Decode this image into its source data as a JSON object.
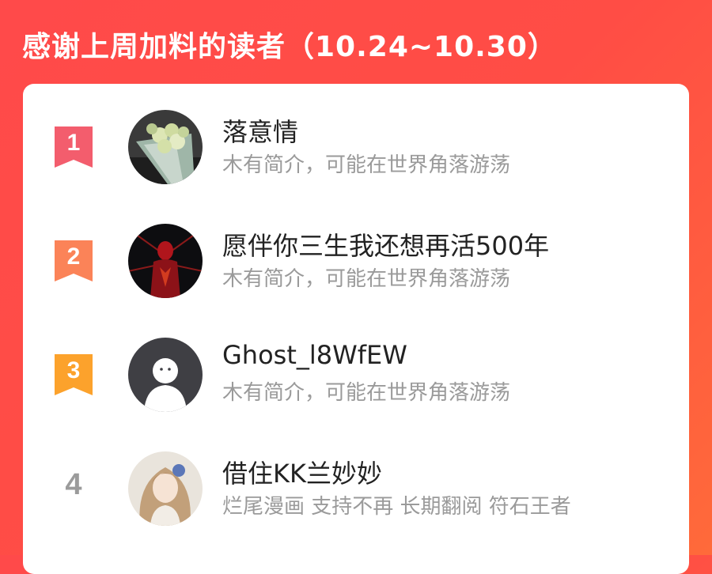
{
  "header": {
    "title": "感谢上周加料的读者（10.24~10.30）"
  },
  "colors": {
    "background": "#ff4a4a",
    "badge_1": "#f35d6d",
    "badge_2": "#fb8358",
    "badge_3": "#fca22c",
    "rank_plain": "#9b9b9b"
  },
  "readers": [
    {
      "rank": "1",
      "name": "落意情",
      "bio": "木有简介，可能在世界角落游荡",
      "avatar_icon": "flower-bouquet-avatar"
    },
    {
      "rank": "2",
      "name": "愿伴你三生我还想再活500年",
      "bio": "木有简介，可能在世界角落游荡",
      "avatar_icon": "spiderman-avatar"
    },
    {
      "rank": "3",
      "name": "Ghost_l8WfEW",
      "bio": "木有简介，可能在世界角落游荡",
      "avatar_icon": "default-ghost-avatar"
    },
    {
      "rank": "4",
      "name": "借住KK兰妙妙",
      "bio": "烂尾漫画 支持不再 长期翻阅 符石王者",
      "avatar_icon": "anime-girl-avatar"
    }
  ]
}
